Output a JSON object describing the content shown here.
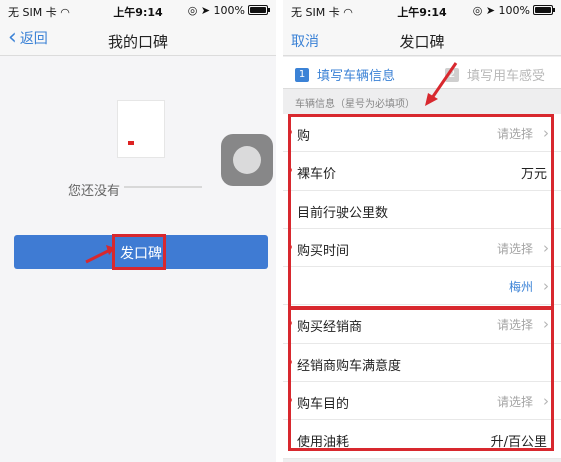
{
  "left": {
    "status": {
      "carrier": "无 SIM 卡",
      "time": "上午9:14",
      "battery": "100%"
    },
    "nav": {
      "back_label": "返回",
      "title": "我的口碑"
    },
    "empty_text": "您还没有",
    "post_button": "发口碑"
  },
  "right": {
    "status": {
      "carrier": "无 SIM 卡",
      "time": "上午9:14",
      "battery": "100%"
    },
    "nav": {
      "cancel_label": "取消",
      "title": "发口碑"
    },
    "tabs": [
      {
        "num": "1",
        "label": "填写车辆信息"
      },
      {
        "num": "2",
        "label": "填写用车感受"
      }
    ],
    "section_label": "车辆信息（星号为必填项）",
    "rows": [
      {
        "label": "购",
        "value": "请选择"
      },
      {
        "label": "裸车价",
        "value": "万元"
      },
      {
        "label": "目前行驶公里数",
        "value": ""
      },
      {
        "label": "购买时间",
        "value": "请选择"
      },
      {
        "label": "",
        "value": "梅州"
      },
      {
        "label": "购买经销商",
        "value": "请选择"
      },
      {
        "label": "经销商购车满意度",
        "value": ""
      },
      {
        "label": "购车目的",
        "value": "请选择"
      },
      {
        "label": "使用油耗",
        "value": "升/百公里"
      }
    ]
  },
  "colors": {
    "accent_blue": "#3b82d6",
    "button_blue": "#3f7bd3",
    "highlight_red": "#d8282e",
    "placeholder_gray": "#a4a4a4"
  }
}
